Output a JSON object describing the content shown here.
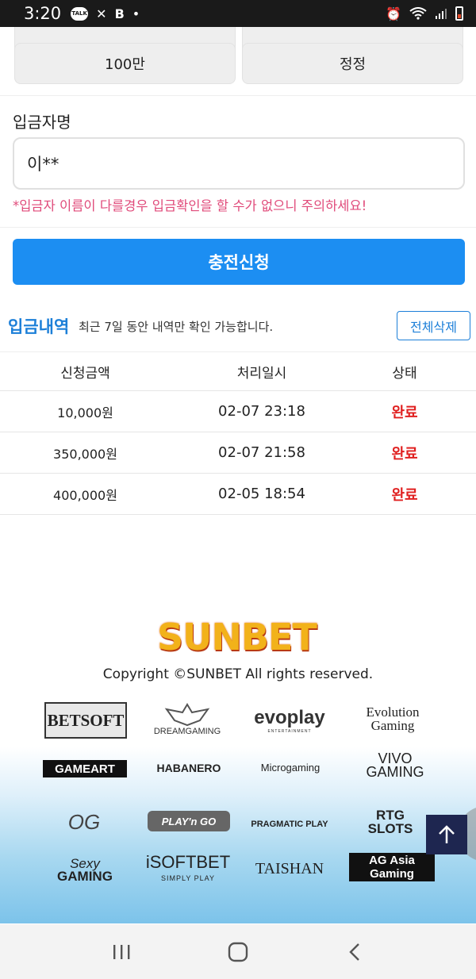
{
  "status_bar": {
    "time": "3:20",
    "talk_badge": "TALK"
  },
  "amount_buttons": {
    "row1": [
      "",
      ""
    ],
    "row2": [
      "100만",
      "정정"
    ]
  },
  "depositor": {
    "label": "입금자명",
    "value": "이**",
    "warning": "*입금자 이름이 다를경우 입금확인을 할 수가 없으니 주의하세요!"
  },
  "submit_label": "충전신청",
  "history": {
    "title": "입금내역",
    "description": "최근 7일 동안 내역만 확인 가능합니다.",
    "delete_all_label": "전체삭제",
    "columns": [
      "신청금액",
      "처리일시",
      "상태"
    ],
    "rows": [
      {
        "amount": "10,000원",
        "date": "02-07 23:18",
        "status": "완료"
      },
      {
        "amount": "350,000원",
        "date": "02-07 21:58",
        "status": "완료"
      },
      {
        "amount": "400,000원",
        "date": "02-05 18:54",
        "status": "완료"
      }
    ]
  },
  "footer": {
    "logo": "SUNBET",
    "copyright": "Copyright ©SUNBET All rights reserved.",
    "providers": {
      "betsoft": "BETSOFT",
      "dreamgaming": "DREAMGAMING",
      "evoplay": "evoplay",
      "evoplay_sub": "ENTERTAINMENT",
      "evolution_line1": "Evolution",
      "evolution_line2": "Gaming",
      "gameart": "GAMEART",
      "habanero": "HABANERO",
      "microgaming": "Microgaming",
      "vivo_line1": "VIVO",
      "vivo_line2": "GAMING",
      "og": "OG",
      "playngo": "PLAY'n GO",
      "pragmatic": "PRAGMATIC PLAY",
      "rtg_line1": "RTG",
      "rtg_line2": "SLOTS",
      "sexy_line1": "Sexy",
      "sexy_line2": "GAMING",
      "isoftbet": "iSOFTBET",
      "isoftbet_sub": "SIMPLY PLAY",
      "taishan": "TAISHAN",
      "ag": "AG Asia Gaming"
    }
  },
  "colors": {
    "primary": "#1c8ef2",
    "accent_blue": "#1c7fd8",
    "status_red": "#e02020",
    "warning_pink": "#e04a7a",
    "dark_navy": "#1e2650"
  }
}
